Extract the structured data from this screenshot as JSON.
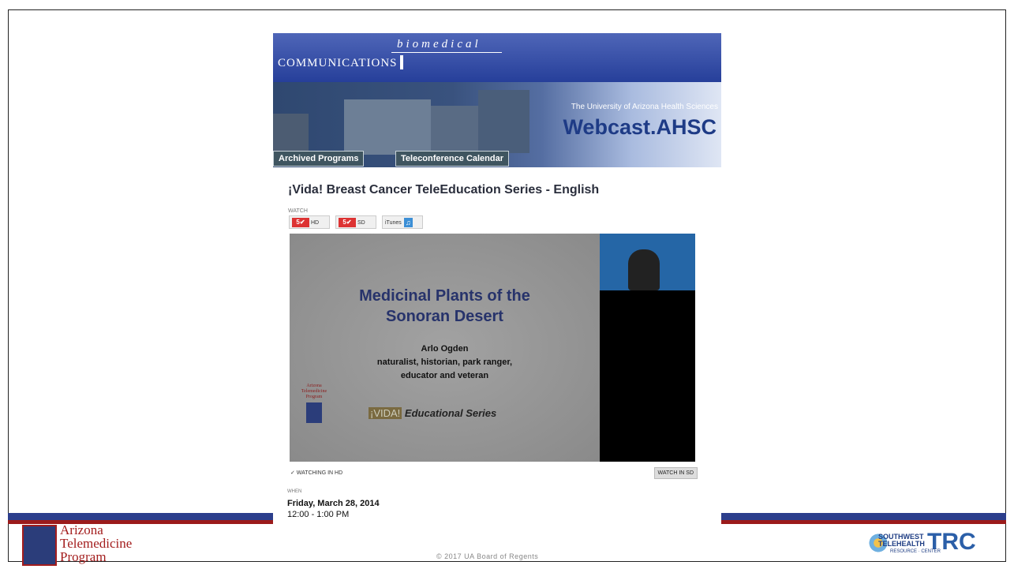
{
  "colors": {
    "header_blue": "#2c3e8c",
    "accent_red": "#9b1b1b",
    "webcast_blue": "#1e3b86"
  },
  "header": {
    "biomedical": "biomedical",
    "communications": "COMMUNICATIONS"
  },
  "banner": {
    "university": "The University of Arizona Health Sciences",
    "webcast": "Webcast.AHSC",
    "tabs": [
      "Archived Programs",
      "Teleconference Calendar"
    ]
  },
  "program": {
    "title": "¡Vida! Breast Cancer TeleEducation Series - English",
    "watch_label": "WATCH",
    "buttons": {
      "hd": "HD",
      "sd": "SD",
      "itunes": "iTunes"
    }
  },
  "video_slide": {
    "title_line1": "Medicinal Plants of the",
    "title_line2": "Sonoran Desert",
    "speaker": "Arlo Ogden",
    "role_line1": "naturalist, historian, park ranger,",
    "role_line2": "educator and veteran",
    "atp_mini": "Arizona Telemedicine Program",
    "series_mark": "¡VIDA!",
    "series": "Educational Series"
  },
  "player": {
    "watching": "✓ WATCHING IN HD",
    "watch_sd": "WATCH IN SD"
  },
  "when": {
    "label": "WHEN",
    "date": "Friday, March 28, 2014",
    "time": "12:00 - 1:00 PM"
  },
  "footer": {
    "atp_line1": "Arizona",
    "atp_line2": "Telemedicine",
    "atp_line3": "Program",
    "copyright": "© 2017 UA Board of Regents",
    "trc_small1": "SOUTHWEST",
    "trc_small2": "TELEHEALTH",
    "trc_big": "TRC",
    "trc_rc": "RESOURCE · CENTER"
  }
}
